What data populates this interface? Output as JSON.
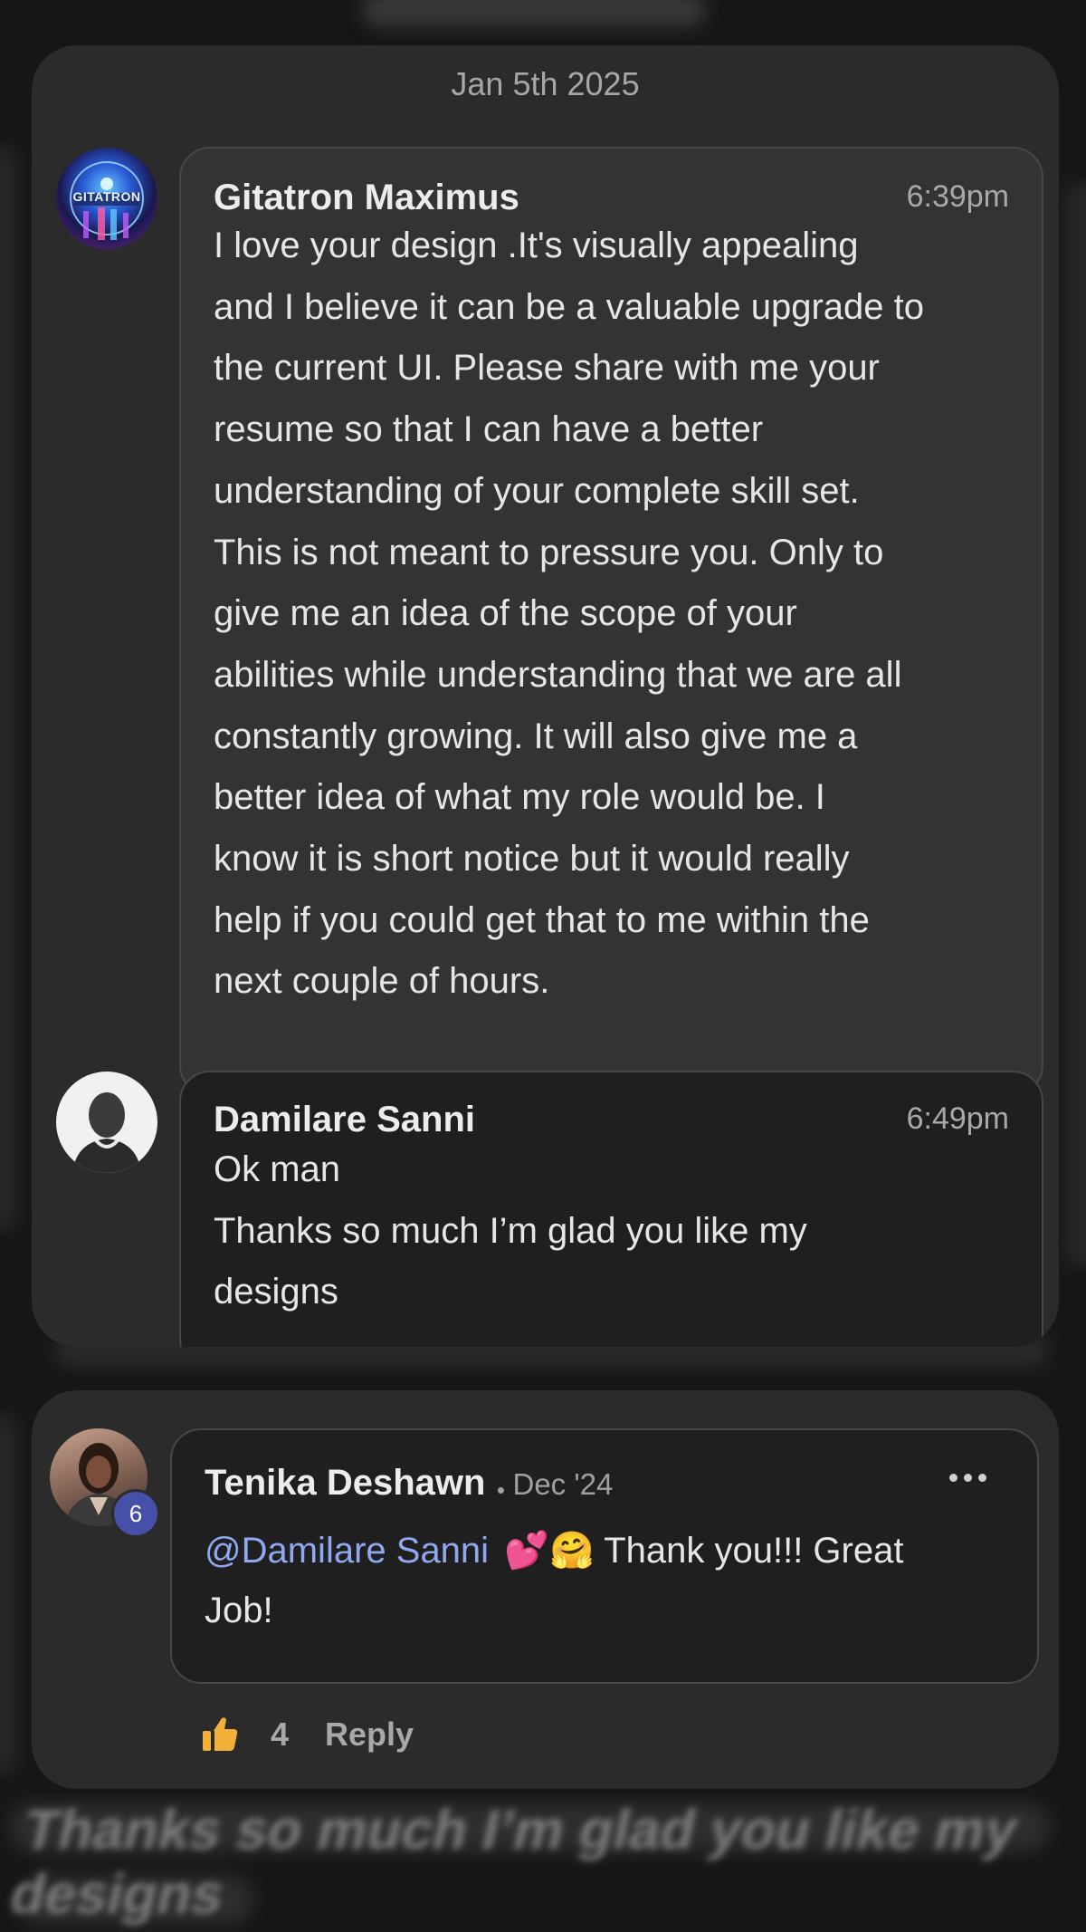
{
  "thread": {
    "date": "Jan 5th 2025",
    "messages": [
      {
        "sender": "Gitatron Maximus",
        "time": "6:39pm",
        "avatar_text": "GITATRON",
        "lines": [
          "I love your design .It's visually appealing",
          "and I believe it can be a valuable upgrade to",
          "the current UI. Please share with me your",
          "resume so that I can have a better",
          "understanding of your complete skill set.",
          "This is not meant to pressure you. Only to",
          "give me an idea of the scope of your",
          "abilities while understanding that we are all",
          "constantly growing. It will also give me a",
          "better idea of what my role would be. I",
          "know it is short notice but it would really",
          "help if you could get that to me within the",
          "next couple of hours."
        ]
      },
      {
        "sender": "Damilare Sanni",
        "time": "6:49pm",
        "lines": [
          "Ok man",
          "Thanks so much I’m glad you like my",
          "designs"
        ]
      }
    ]
  },
  "comment": {
    "author": "Tenika Deshawn",
    "separator": "•",
    "date": "Dec '24",
    "badge_count": "6",
    "mention": "@Damilare Sanni",
    "emojis": "💕🤗",
    "text_line1": "Thank you!!! Great",
    "text_line2": "Job!",
    "more_icon": "more-horizontal-icon",
    "like_count": "4",
    "reply_label": "Reply",
    "like_icon": "thumbs-up-icon",
    "like_color": "#f2b23a"
  },
  "background_text": {
    "bottom_line1": "Thanks so much I’m glad you like my",
    "bottom_line2": "designs"
  }
}
